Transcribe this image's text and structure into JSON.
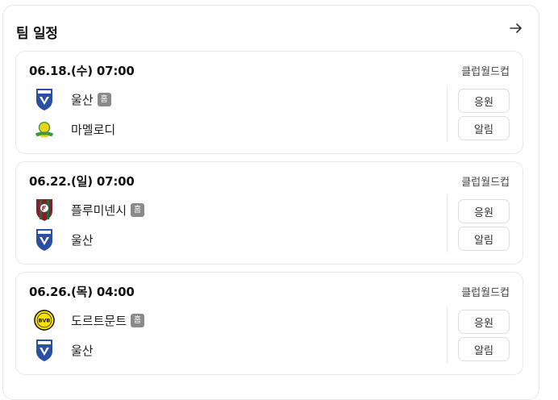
{
  "header": {
    "title": "팀 일정",
    "more_icon": "arrow-right-icon"
  },
  "colors": {
    "ulsan_blue": "#2b4fa3",
    "fluminense_maroon": "#8a1c2b",
    "fluminense_green": "#1f6b3a",
    "bvb_yellow": "#fde100",
    "sundowns_yellow": "#f2d21a",
    "sundowns_green": "#3a9a3a",
    "home_badge": "#8a8a8a"
  },
  "matches": [
    {
      "date": "06.18.(수) 07:00",
      "competition": "클럽월드컵",
      "home_team": {
        "name": "울산",
        "logo": "ulsan-logo-icon",
        "badge": "홈"
      },
      "away_team": {
        "name": "마멜로디",
        "logo": "mamelodi-logo-icon"
      },
      "cheer_label": "응원",
      "alarm_label": "알림"
    },
    {
      "date": "06.22.(일) 07:00",
      "competition": "클럽월드컵",
      "home_team": {
        "name": "플루미넨시",
        "logo": "fluminense-logo-icon",
        "badge": "홈"
      },
      "away_team": {
        "name": "울산",
        "logo": "ulsan-logo-icon"
      },
      "cheer_label": "응원",
      "alarm_label": "알림"
    },
    {
      "date": "06.26.(목) 04:00",
      "competition": "클럽월드컵",
      "home_team": {
        "name": "도르트문트",
        "logo": "dortmund-logo-icon",
        "badge": "홈"
      },
      "away_team": {
        "name": "울산",
        "logo": "ulsan-logo-icon"
      },
      "cheer_label": "응원",
      "alarm_label": "알림"
    }
  ]
}
